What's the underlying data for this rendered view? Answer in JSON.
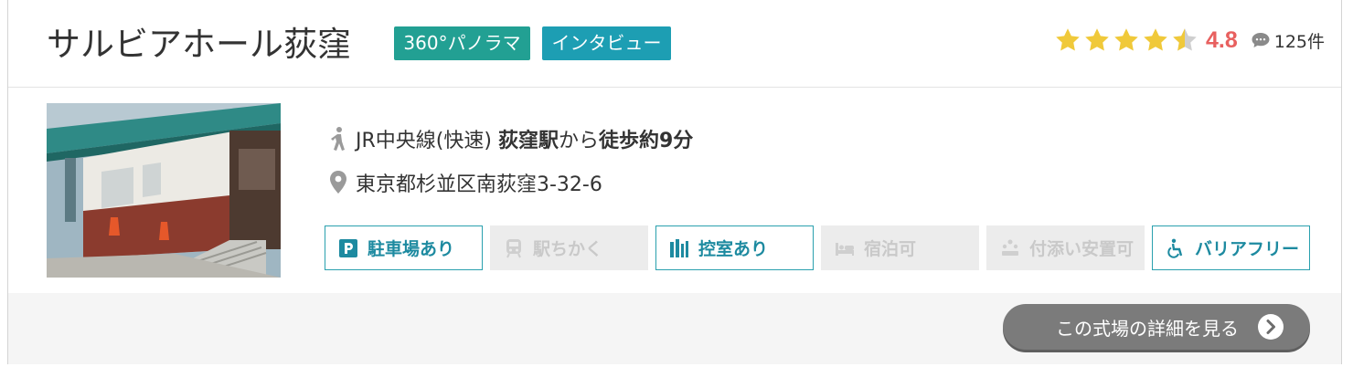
{
  "venue": {
    "name": "サルビアホール荻窪",
    "badges": {
      "panorama": "360°パノラマ",
      "interview": "インタビュー"
    },
    "rating": {
      "score": "4.8",
      "stars": 4.5,
      "reviews": "125件"
    },
    "access": {
      "line": "JR中央線(快速) ",
      "station": "荻窪駅",
      "from": "から",
      "walk": "徒歩約9分"
    },
    "address": "東京都杉並区南荻窪3-32-6"
  },
  "features": [
    {
      "label": "駐車場あり",
      "icon": "parking-icon",
      "active": true
    },
    {
      "label": "駅ちかく",
      "icon": "train-icon",
      "active": false
    },
    {
      "label": "控室あり",
      "icon": "waiting-room-icon",
      "active": true
    },
    {
      "label": "宿泊可",
      "icon": "bed-icon",
      "active": false
    },
    {
      "label": "付添い安置可",
      "icon": "attendants-icon",
      "active": false
    },
    {
      "label": "バリアフリー",
      "icon": "wheelchair-icon",
      "active": true
    }
  ],
  "detail_button": {
    "label": "この式場の詳細を見る"
  },
  "colors": {
    "accent": "#1d8aa0",
    "panorama_badge": "#22a093",
    "interview_badge": "#1d9eb3",
    "score": "#e8605f",
    "star": "#f0c93a",
    "button": "#7b7b7b"
  }
}
